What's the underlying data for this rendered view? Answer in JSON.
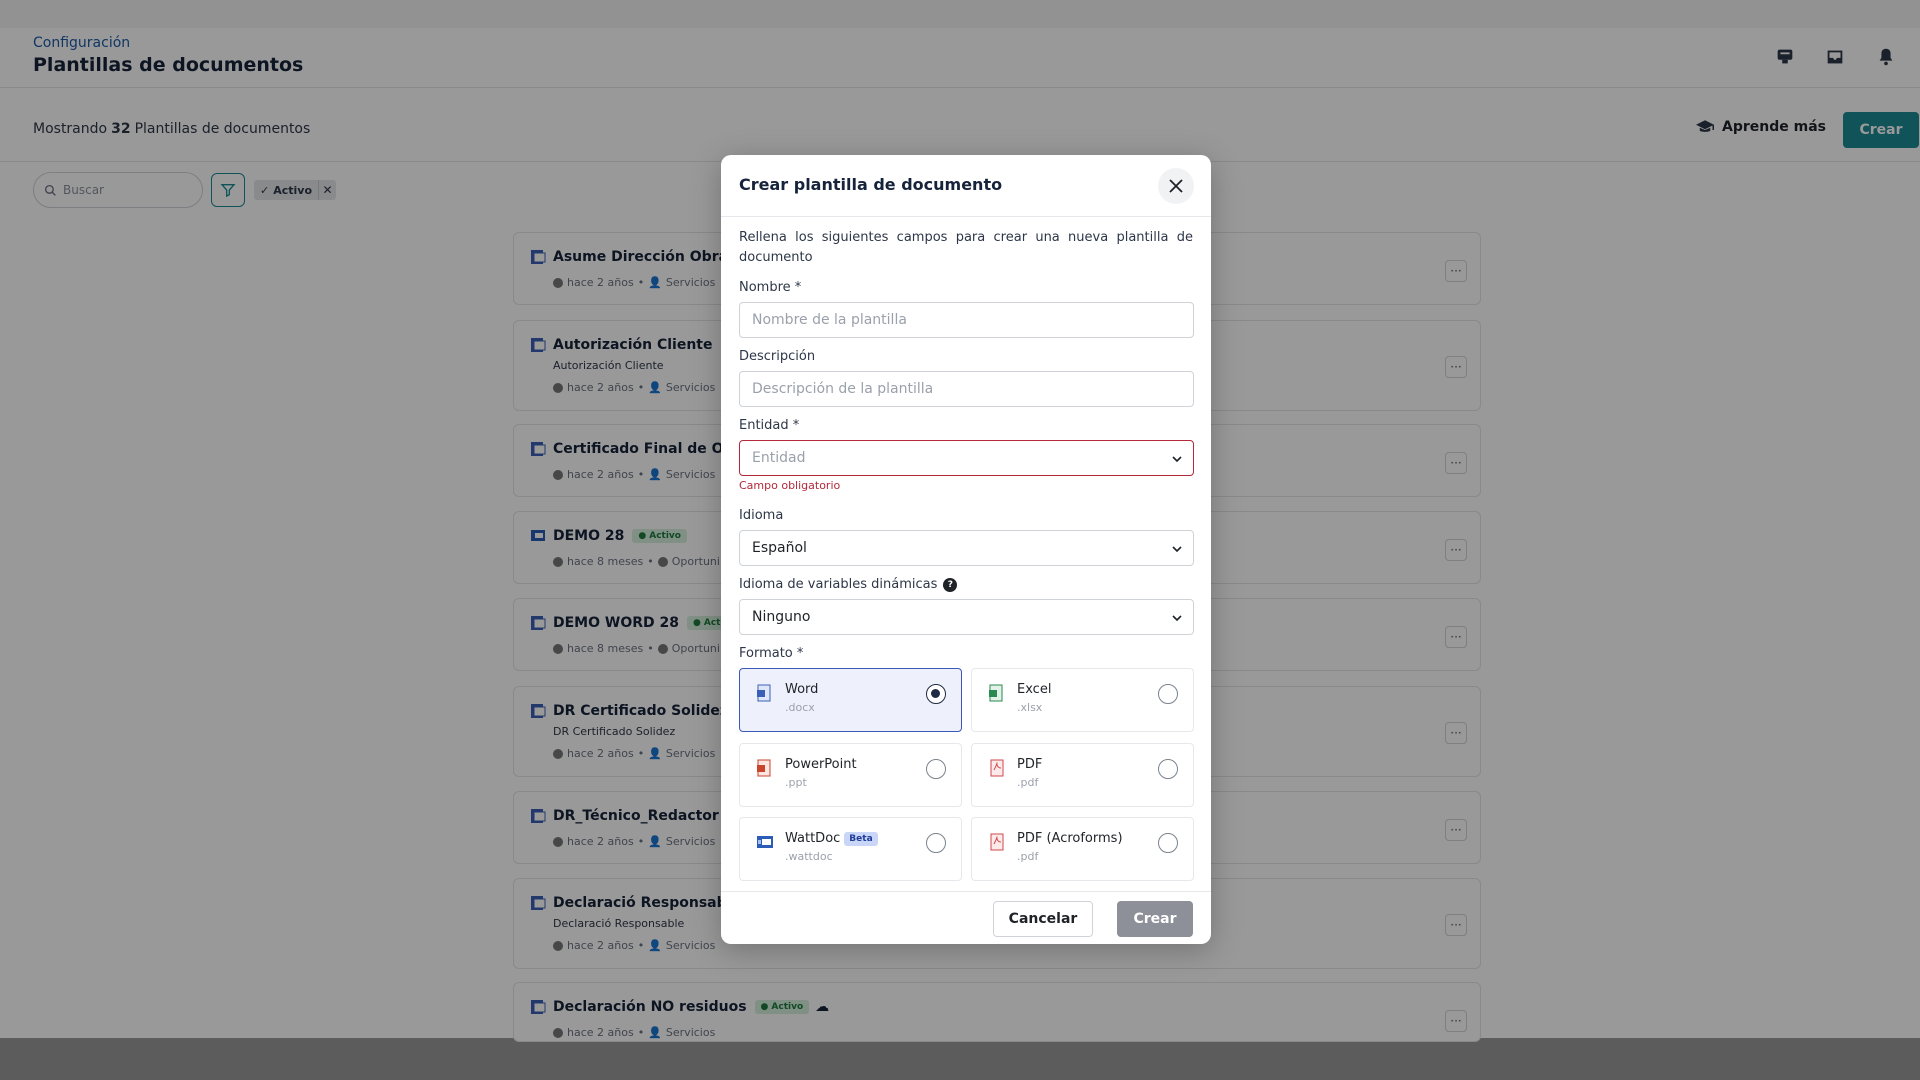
{
  "header": {
    "breadcrumb": "Configuración",
    "title": "Plantillas de documentos",
    "icons": [
      "chat-icon",
      "inbox-icon",
      "bell-icon"
    ]
  },
  "toolbar": {
    "showing_prefix": "Mostrando",
    "count": "32",
    "showing_suffix": "Plantillas de documentos",
    "learn_more": "Aprende más",
    "create": "Crear"
  },
  "filters": {
    "search_placeholder": "Buscar",
    "chip_label": "Activo",
    "chip_remove": "✕"
  },
  "list": {
    "items": [
      {
        "name": "Asume Dirección Obras",
        "sub": "",
        "time": "hace 2 años",
        "owner": "Servicios"
      },
      {
        "name": "Autorización Cliente",
        "sub": "Autorización Cliente",
        "time": "hace 2 años",
        "owner": "Servicios"
      },
      {
        "name": "Certificado Final de Obr",
        "sub": "",
        "time": "hace 2 años",
        "owner": "Servicios"
      },
      {
        "name": "DEMO 28",
        "badge": "Activo",
        "sub": "",
        "time": "hace 8 meses",
        "owner": "Oportuni"
      },
      {
        "name": "DEMO WORD 28",
        "badge": "Activo",
        "sub": "",
        "time": "hace 8 meses",
        "owner": "Oportuni"
      },
      {
        "name": "DR Certificado Solidez",
        "sub": "DR Certificado Solidez",
        "time": "hace 2 años",
        "owner": "Servicios"
      },
      {
        "name": "DR_Técnico_Redactor",
        "sub": "",
        "time": "hace 2 años",
        "owner": "Servicios"
      },
      {
        "name": "Declaració Responsable",
        "sub": "Declaració Responsable",
        "time": "hace 2 años",
        "owner": "Servicios"
      },
      {
        "name": "Declaración NO residuos",
        "badge": "Activo",
        "sub": "",
        "time": "hace 2 años",
        "owner": "Servicios"
      }
    ],
    "more_label": "···"
  },
  "modal": {
    "title": "Crear plantilla de documento",
    "intro": "Rellena los siguientes campos para crear una nueva plantilla de documento",
    "name_label": "Nombre *",
    "name_placeholder": "Nombre de la plantilla",
    "desc_label": "Descripción",
    "desc_placeholder": "Descripción de la plantilla",
    "entity_label": "Entidad *",
    "entity_placeholder": "Entidad",
    "entity_error": "Campo obligatorio",
    "lang_label": "Idioma",
    "lang_value": "Español",
    "varlang_label": "Idioma de variables dinámicas",
    "varlang_value": "Ninguno",
    "format_label": "Formato *",
    "formats": [
      {
        "name": "Word",
        "ext": ".docx",
        "selected": true
      },
      {
        "name": "Excel",
        "ext": ".xlsx",
        "selected": false
      },
      {
        "name": "PowerPoint",
        "ext": ".ppt",
        "selected": false
      },
      {
        "name": "PDF",
        "ext": ".pdf",
        "selected": false
      },
      {
        "name": "WattDoc",
        "ext": ".wattdoc",
        "badge": "Beta",
        "selected": false
      },
      {
        "name": "PDF (Acroforms)",
        "ext": ".pdf",
        "selected": false
      }
    ],
    "cancel": "Cancelar",
    "create": "Crear"
  },
  "colors": {
    "accent": "#1b8a95",
    "error": "#b3283b",
    "selected": "#3b58b8",
    "badge_active": "#d5f0dd"
  }
}
